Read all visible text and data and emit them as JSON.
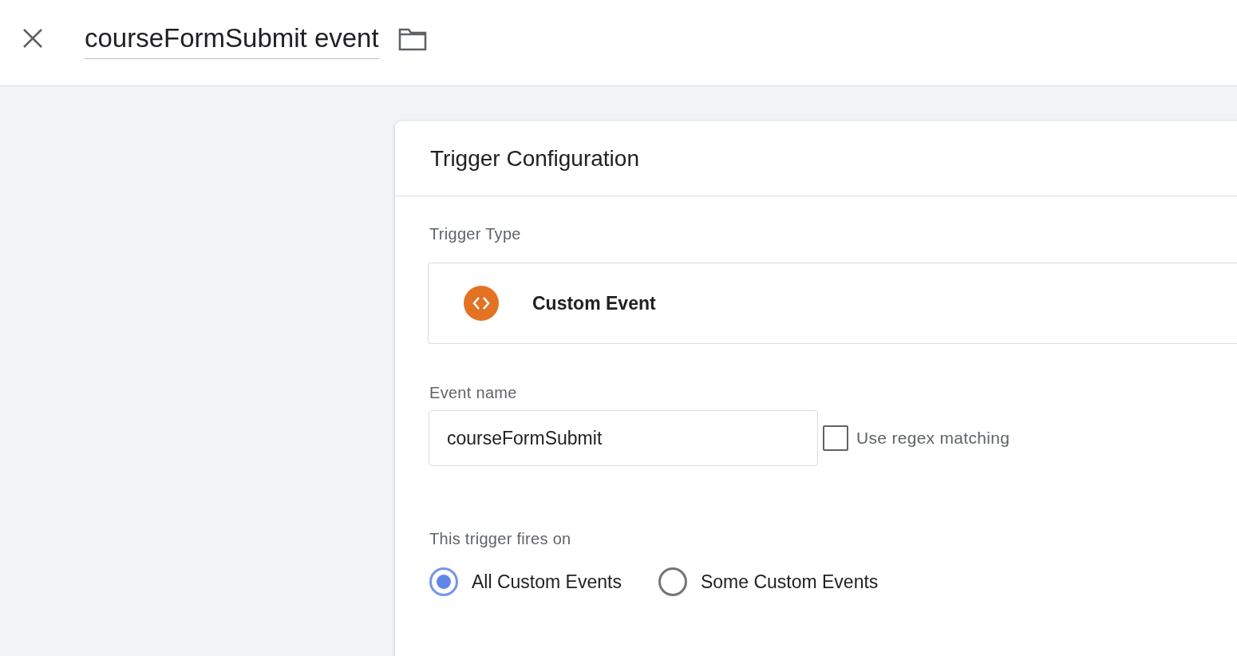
{
  "header": {
    "title": "courseFormSubmit event"
  },
  "card": {
    "title": "Trigger Configuration",
    "trigger_type": {
      "label": "Trigger Type",
      "value": "Custom Event"
    },
    "event_name": {
      "label": "Event name",
      "value": "courseFormSubmit",
      "regex": {
        "label": "Use regex matching",
        "checked": false
      }
    },
    "fires_on": {
      "label": "This trigger fires on",
      "options": [
        {
          "label": "All Custom Events",
          "selected": true
        },
        {
          "label": "Some Custom Events",
          "selected": false
        }
      ]
    }
  }
}
